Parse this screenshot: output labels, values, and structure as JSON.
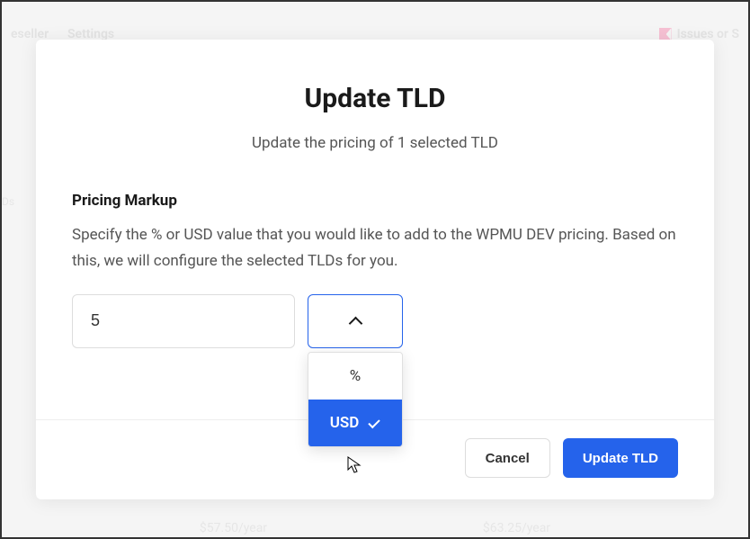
{
  "background": {
    "nav_left_1": "eseller",
    "nav_left_2": "Settings",
    "nav_right": "Issues or S",
    "sidebar_item": "Ds",
    "price_left": "$57.50/year",
    "price_right": "$63.25/year"
  },
  "modal": {
    "title": "Update TLD",
    "subtitle": "Update the pricing of 1 selected TLD",
    "section_label": "Pricing Markup",
    "helper_text": "Specify the % or USD value that you would like to add to the WPMU DEV pricing. Based on this, we will configure the selected TLDs for you.",
    "input_value": "5",
    "dropdown": {
      "option_percent": "%",
      "option_usd": "USD",
      "selected": "USD"
    },
    "footer": {
      "cancel": "Cancel",
      "confirm": "Update TLD"
    }
  }
}
